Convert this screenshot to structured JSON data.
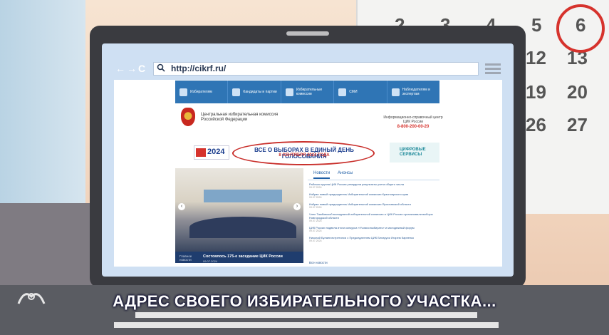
{
  "caption": "АДРЕС СВОЕГО ИЗБИРАТЕЛЬНОГО УЧАСТКА...",
  "calendar": {
    "numbers": [
      "2",
      "3",
      "4",
      "5",
      "6",
      "12",
      "13",
      "19",
      "20",
      "26",
      "27"
    ]
  },
  "browser": {
    "nav_glyphs": "←→C",
    "url": "http://cikrf.ru/"
  },
  "site": {
    "nav": [
      "Избирателям",
      "Кандидаты и партии",
      "Избирательные комиссии",
      "СМИ",
      "Наблюдателям и экспертам"
    ],
    "org_name": "Центральная избирательная комиссия Российской Федерации",
    "info_center": "Информационно-справочный центр ЦИК России",
    "phone": "8-800-200-00-20",
    "banner_logo": "2024",
    "banner_title": "ВСЕ О ВЫБОРАХ В ЕДИНЫЙ ДЕНЬ ГОЛОСОВАНИЯ",
    "banner_date": "8 СЕНТЯБРЯ 2024 ГОДА",
    "digital": "ЦИФРОВЫЕ СЕРВИСЫ",
    "photo_label": "Главное новости",
    "photo_title": "Состоялось 175-е заседание ЦИК России",
    "photo_date": "09.07.2024",
    "tabs": [
      "Новости",
      "Анонсы"
    ],
    "news": [
      {
        "title": "Рабочая группа ЦИК России утвердила результаты учета общего числа",
        "date": "09.07.2024"
      },
      {
        "title": "Избран новый председатель Избирательной комиссии Красноярского края",
        "date": "09.07.2024"
      },
      {
        "title": "Избран новый председатель Избирательной комиссии Ярославской области",
        "date": "09.07.2024"
      },
      {
        "title": "Член Тамбовской молодежной избирательной комиссии и ЦИК России организовали выборы Новгородской области",
        "date": "09.07.2024"
      },
      {
        "title": "ЦИК России подвела итоги конкурса «Учимся выбирать» и молодежный форум",
        "date": "09.07.2024"
      },
      {
        "title": "Николай Булаев встретился с Председателем ЦИК Беларуси Игорем Карпенко",
        "date": "09.07.2024"
      }
    ],
    "all_news": "Все новости"
  }
}
